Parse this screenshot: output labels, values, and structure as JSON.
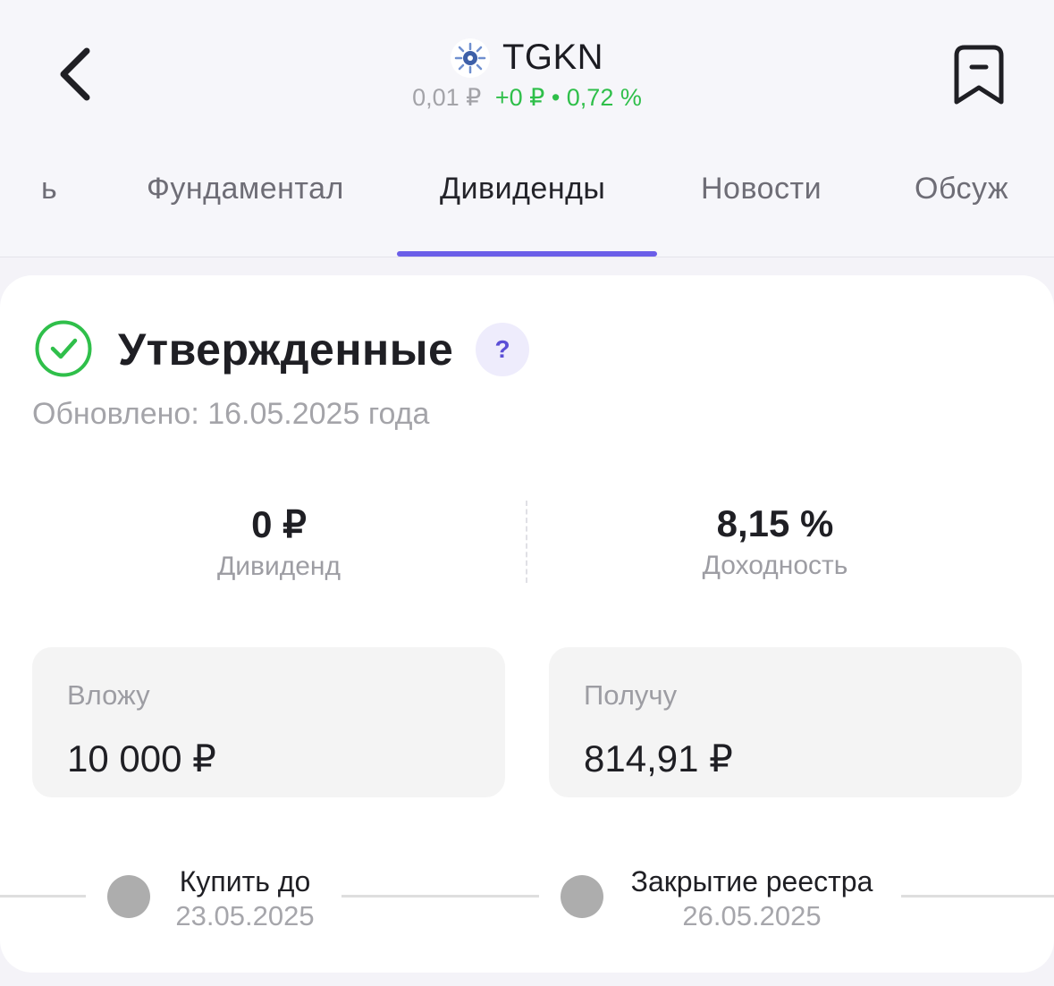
{
  "header": {
    "ticker": "TGKN",
    "price": "0,01 ₽",
    "change": "+0 ₽ • 0,72 %"
  },
  "tabs": [
    {
      "label": "ь"
    },
    {
      "label": "Фундаментал"
    },
    {
      "label": "Дивиденды",
      "active": true
    },
    {
      "label": "Новости"
    },
    {
      "label": "Обсуж"
    }
  ],
  "dividend": {
    "status_title": "Утвержденные",
    "help_label": "?",
    "updated": "Обновлено: 16.05.2025 года",
    "dividend_value": "0 ₽",
    "dividend_label": "Дивиденд",
    "yield_value": "8,15 %",
    "yield_label": "Доходность",
    "invest_label": "Вложу",
    "invest_value": "10 000 ₽",
    "receive_label": "Получу",
    "receive_value": "814,91 ₽"
  },
  "timeline": [
    {
      "title": "Купить до",
      "date": "23.05.2025"
    },
    {
      "title": "Закрытие реестра",
      "date": "26.05.2025"
    }
  ],
  "colors": {
    "accent": "#6b5ee8",
    "positive": "#2fbf4a",
    "help_bg": "#eeecfc"
  }
}
